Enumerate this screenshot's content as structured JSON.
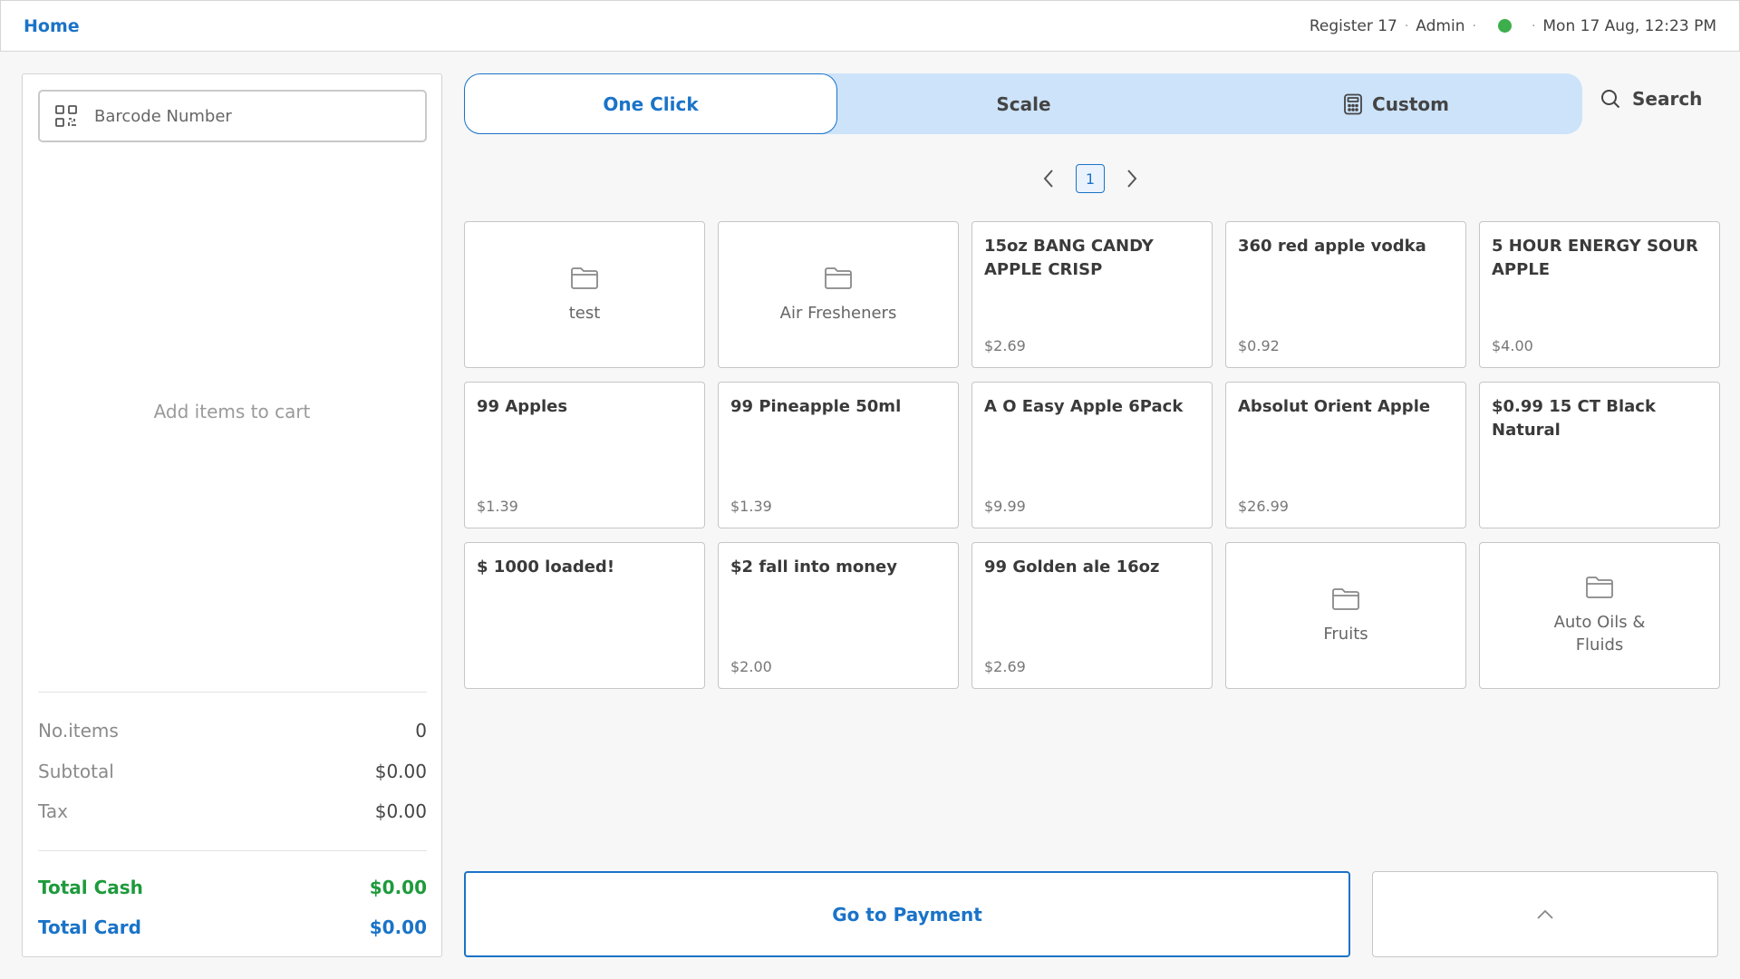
{
  "header": {
    "home_label": "Home",
    "register": "Register 17",
    "separator": "·",
    "user": "Admin",
    "status_color": "#3cae4b",
    "datetime": "Mon 17 Aug, 12:23 PM"
  },
  "cart": {
    "barcode_placeholder": "Barcode Number",
    "empty_message": "Add items to cart",
    "summary": {
      "items_label": "No.items",
      "items_value": "0",
      "subtotal_label": "Subtotal",
      "subtotal_value": "$0.00",
      "tax_label": "Tax",
      "tax_value": "$0.00",
      "total_cash_label": "Total Cash",
      "total_cash_value": "$0.00",
      "total_card_label": "Total Card",
      "total_card_value": "$0.00"
    }
  },
  "tabs": [
    {
      "label": "One Click",
      "active": true
    },
    {
      "label": "Scale",
      "active": false
    },
    {
      "label": "Custom",
      "active": false,
      "icon": "calculator-icon"
    }
  ],
  "search_label": "Search",
  "pagination": {
    "current_page": "1"
  },
  "tiles": [
    {
      "type": "folder",
      "name": "test"
    },
    {
      "type": "folder",
      "name": "Air Fresheners"
    },
    {
      "type": "product",
      "name": "15oz BANG CANDY APPLE CRISP",
      "price": "$2.69"
    },
    {
      "type": "product",
      "name": "360 red apple vodka",
      "price": "$0.92"
    },
    {
      "type": "product",
      "name": "5 HOUR ENERGY SOUR APPLE",
      "price": "$4.00"
    },
    {
      "type": "product",
      "name": "99 Apples",
      "price": "$1.39"
    },
    {
      "type": "product",
      "name": "99 Pineapple 50ml",
      "price": "$1.39"
    },
    {
      "type": "product",
      "name": "A O Easy Apple 6Pack",
      "price": "$9.99"
    },
    {
      "type": "product",
      "name": "Absolut Orient Apple",
      "price": "$26.99"
    },
    {
      "type": "product",
      "name": "$0.99 15 CT Black Natural",
      "price": ""
    },
    {
      "type": "product",
      "name": "$ 1000 loaded!",
      "price": ""
    },
    {
      "type": "product",
      "name": "$2 fall into money",
      "price": "$2.00"
    },
    {
      "type": "product",
      "name": "99 Golden ale 16oz",
      "price": "$2.69"
    },
    {
      "type": "folder",
      "name": "Fruits"
    },
    {
      "type": "folder",
      "name": "Auto Oils & Fluids"
    }
  ],
  "actions": {
    "payment_label": "Go to Payment"
  },
  "colors": {
    "accent": "#1a73c8",
    "cash": "#1e9a3c",
    "tab_bg": "#cde3fa"
  }
}
